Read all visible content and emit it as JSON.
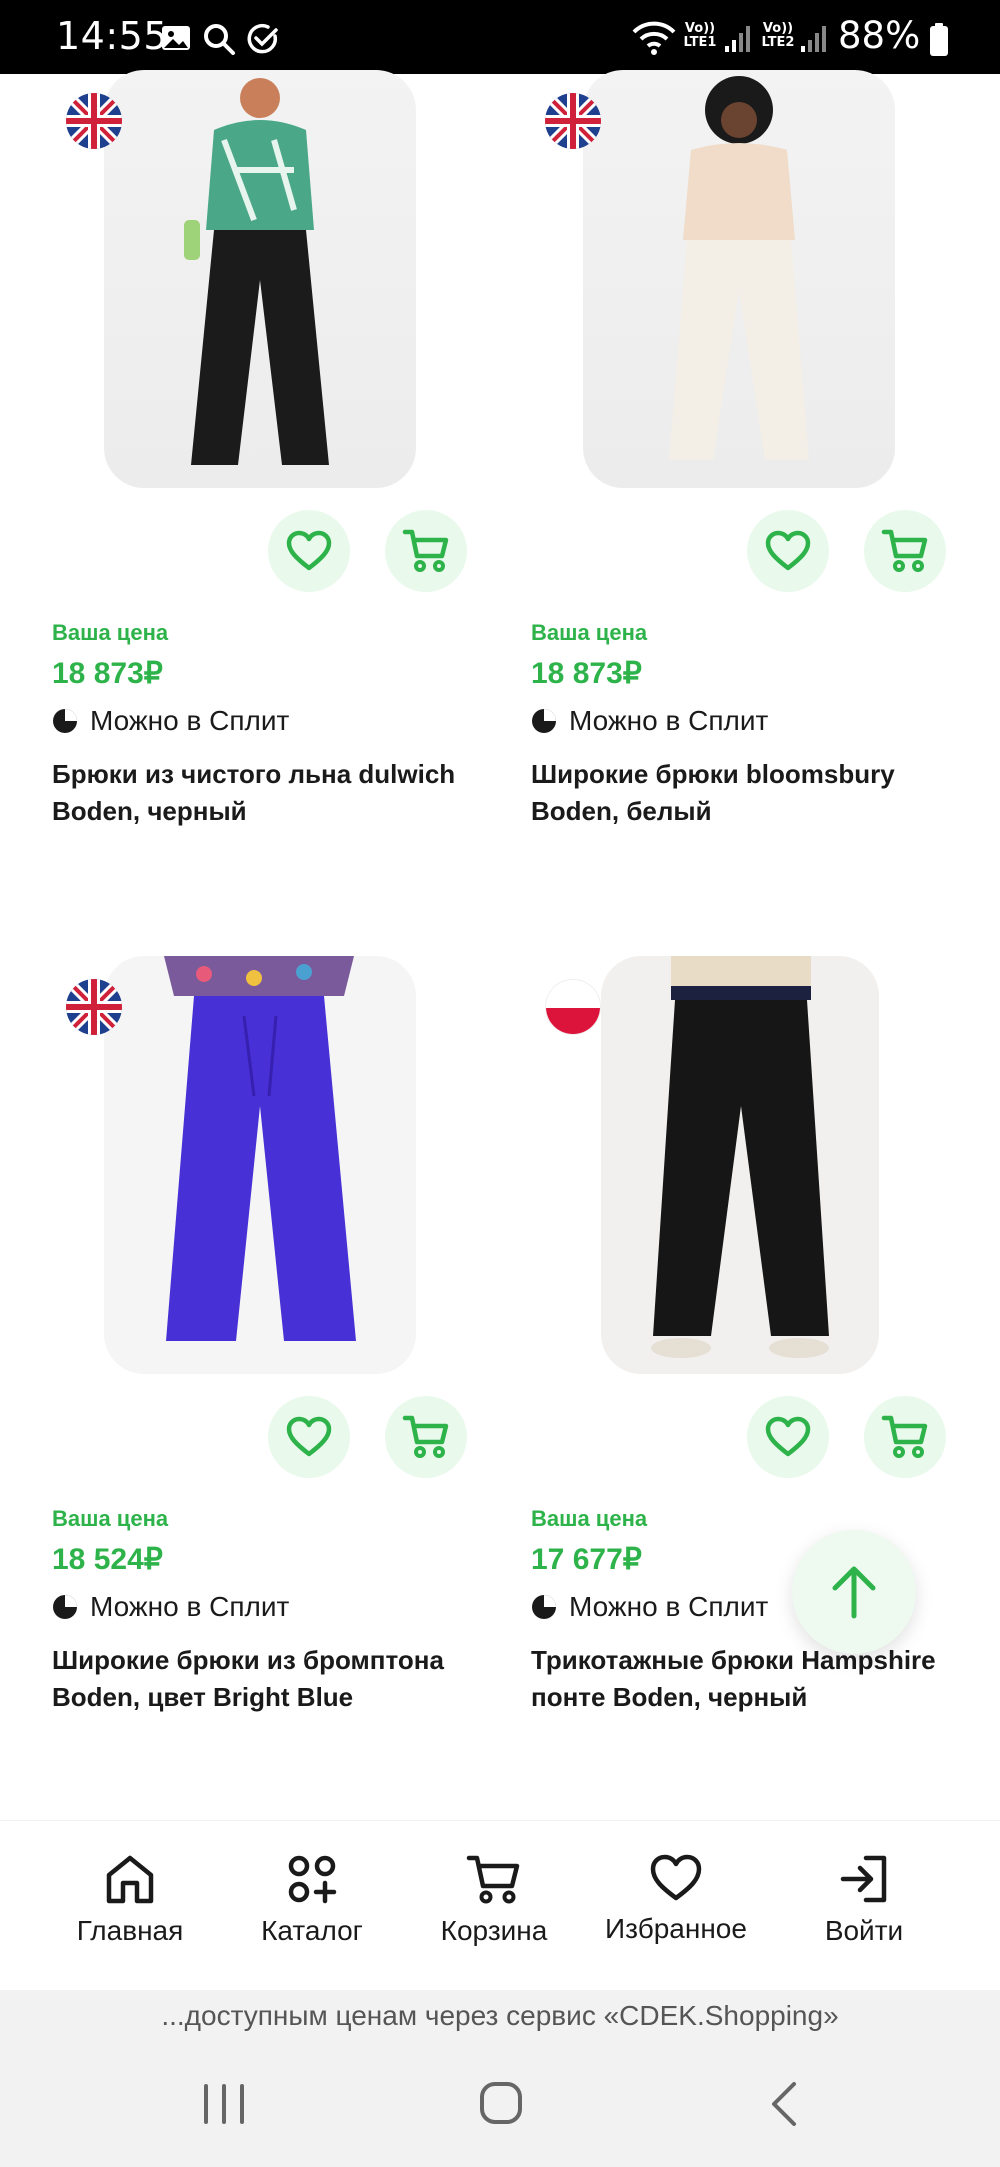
{
  "status_bar": {
    "time": "14:55",
    "battery": "88%",
    "sim1": "Vo))\nLTE1",
    "sim2": "Vo))\nLTE2",
    "icons": [
      "gallery-icon",
      "search-icon",
      "check-circle-icon",
      "wifi-icon",
      "signal-icon",
      "battery-icon"
    ]
  },
  "products": [
    {
      "flag": "uk",
      "price_label": "Ваша цена",
      "price": "18 873₽",
      "split": "Можно в Сплит",
      "title": "Брюки из чистого льна dulwich Boden, черный",
      "image": "woman in green floral blouse and black wide trousers"
    },
    {
      "flag": "uk",
      "price_label": "Ваша цена",
      "price": "18 873₽",
      "split": "Можно в Сплит",
      "title": "Широкие брюки bloomsbury Boden, белый",
      "image": "woman in beige sweater and white wide trousers"
    },
    {
      "flag": "uk",
      "price_label": "Ваша цена",
      "price": "18 524₽",
      "split": "Можно в Сплит",
      "title": "Широкие брюки из бромптона Boden, цвет Bright Blue",
      "image": "bright blue pleated wide trousers"
    },
    {
      "flag": "pl",
      "price_label": "Ваша цена",
      "price": "17 677₽",
      "split": "Можно в Сплит",
      "title": "Трикотажные брюки Hampshire понте Boden, черный",
      "image": "black knit trousers with beige top"
    }
  ],
  "nav": {
    "home": "Главная",
    "catalog": "Каталог",
    "cart": "Корзина",
    "favorites": "Избранное",
    "login": "Войти"
  },
  "banner": "...доступным ценам через сервис «CDEK.Shopping»",
  "colors": {
    "accent": "#2db34a",
    "accent_light": "#e9f9ec",
    "text": "#1a1a1a"
  }
}
